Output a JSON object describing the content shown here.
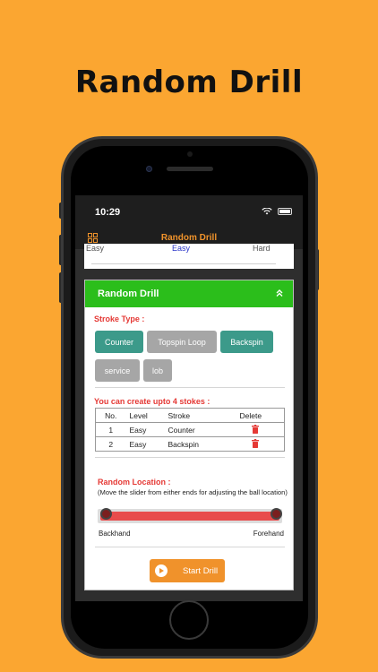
{
  "headline": "Random Drill",
  "status": {
    "time": "10:29"
  },
  "nav": {
    "title": "Random Drill"
  },
  "levels": {
    "easy_left": "Easy",
    "easy_mid": "Easy",
    "hard": "Hard"
  },
  "card": {
    "title": "Random Drill",
    "stroke_type_label": "Stroke Type :",
    "stroke_options": [
      {
        "label": "Counter",
        "selected": true
      },
      {
        "label": "Topspin Loop",
        "selected": false
      },
      {
        "label": "Backspin",
        "selected": true
      },
      {
        "label": "service",
        "selected": false
      },
      {
        "label": "lob",
        "selected": false
      }
    ],
    "create_label": "You can create upto 4 stokes :",
    "table": {
      "headers": {
        "no": "No.",
        "level": "Level",
        "stroke": "Stroke",
        "delete": "Delete"
      },
      "rows": [
        {
          "no": "1",
          "level": "Easy",
          "stroke": "Counter"
        },
        {
          "no": "2",
          "level": "Easy",
          "stroke": "Backspin"
        }
      ]
    },
    "random_location_label": "Random Location :",
    "random_location_hint": "(Move the slider from either ends for adjusting the ball location)",
    "slider": {
      "left_label": "Backhand",
      "right_label": "Forehand",
      "range_start": 0.0,
      "range_end": 1.0
    },
    "start_button": "Start Drill"
  },
  "colors": {
    "background": "#FBA631",
    "header_green": "#2BBE1B",
    "accent_orange": "#F0922B",
    "label_red": "#E53935",
    "chip_teal": "#3C9A8A",
    "chip_grey": "#A6A6A6"
  }
}
